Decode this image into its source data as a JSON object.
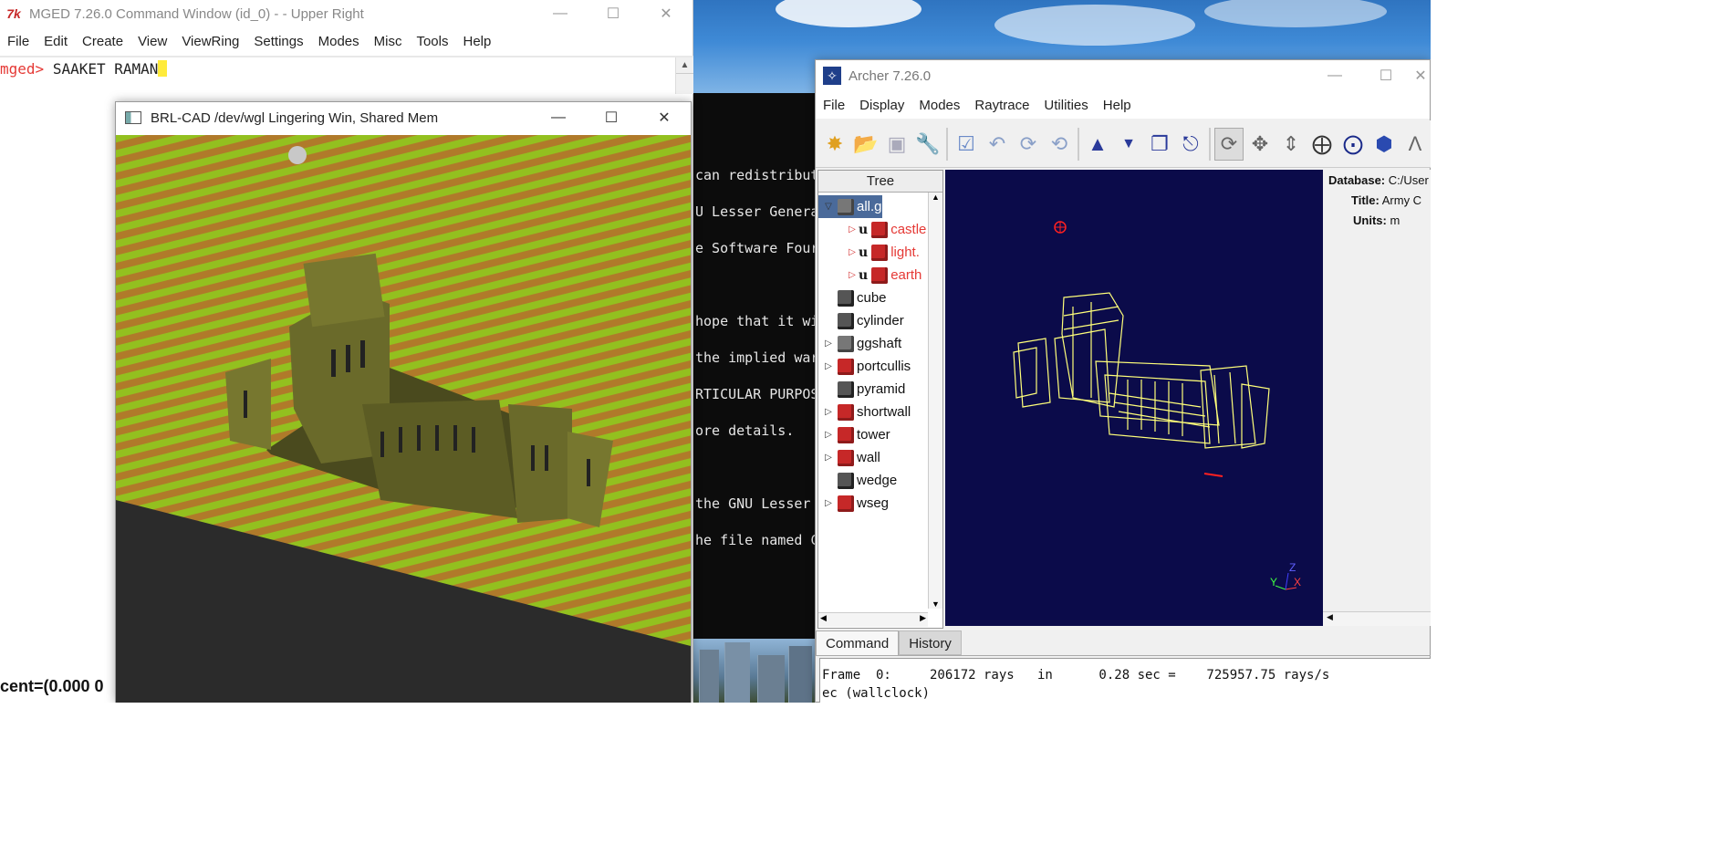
{
  "mged": {
    "title": "MGED 7.26.0 Command Window (id_0) -  - Upper Right",
    "icon": "tk-feather-icon",
    "menu": [
      "File",
      "Edit",
      "Create",
      "View",
      "ViewRing",
      "Settings",
      "Modes",
      "Misc",
      "Tools",
      "Help"
    ],
    "prompt": "mged>",
    "command": "SAAKET RAMAN",
    "status": "cent=(0.000 0"
  },
  "wgl": {
    "title": "BRL-CAD /dev/wgl Lingering Win, Shared Mem",
    "colors": {
      "stripe_a": "#93c01f",
      "stripe_b": "#b07a2a",
      "castle": "#6a6a2a",
      "ground": "#2b2b2b"
    }
  },
  "terminal": {
    "lines": [
      "can redistribut",
      "U Lesser Genera",
      "e Software Four",
      "",
      "hope that it wi",
      "the implied war",
      "RTICULAR PURPOS",
      "ore details.",
      "",
      "the GNU Lesser",
      "he file named C"
    ]
  },
  "archer": {
    "title": "Archer 7.26.0",
    "menu": [
      "File",
      "Display",
      "Modes",
      "Raytrace",
      "Utilities",
      "Help"
    ],
    "tree_header": "Tree",
    "tree": [
      {
        "label": "all.g",
        "kind": "grp",
        "expand": "open",
        "selected": true
      },
      {
        "label": "castle",
        "kind": "comb",
        "expand": "closed",
        "union": "u",
        "child": true,
        "red": true
      },
      {
        "label": "light.",
        "kind": "comb",
        "expand": "closed",
        "union": "u",
        "child": true,
        "red": true
      },
      {
        "label": "earth",
        "kind": "comb",
        "expand": "closed",
        "union": "u",
        "child": true,
        "red": true
      },
      {
        "label": "cube",
        "kind": "prim",
        "expand": ""
      },
      {
        "label": "cylinder",
        "kind": "prim",
        "expand": ""
      },
      {
        "label": "ggshaft",
        "kind": "grp",
        "expand": "closed"
      },
      {
        "label": "portcullis",
        "kind": "comb",
        "expand": "closed"
      },
      {
        "label": "pyramid",
        "kind": "prim",
        "expand": ""
      },
      {
        "label": "shortwall",
        "kind": "comb",
        "expand": "closed"
      },
      {
        "label": "tower",
        "kind": "comb",
        "expand": "closed"
      },
      {
        "label": "wall",
        "kind": "comb",
        "expand": "closed"
      },
      {
        "label": "wedge",
        "kind": "prim",
        "expand": ""
      },
      {
        "label": "wseg",
        "kind": "comb",
        "expand": "closed"
      }
    ],
    "props": [
      {
        "key": "Database:",
        "value": "C:/User"
      },
      {
        "key": "Title:",
        "value": "Army C"
      },
      {
        "key": "Units:",
        "value": "m"
      }
    ],
    "cmd_tabs": [
      "Command",
      "History"
    ],
    "output": [
      "Frame  0:     206172 rays   in      0.28 sec =    725957.75 rays/s",
      "ec (wallclock)"
    ],
    "axes": {
      "x": "X",
      "y": "Y",
      "z": "Z"
    }
  }
}
